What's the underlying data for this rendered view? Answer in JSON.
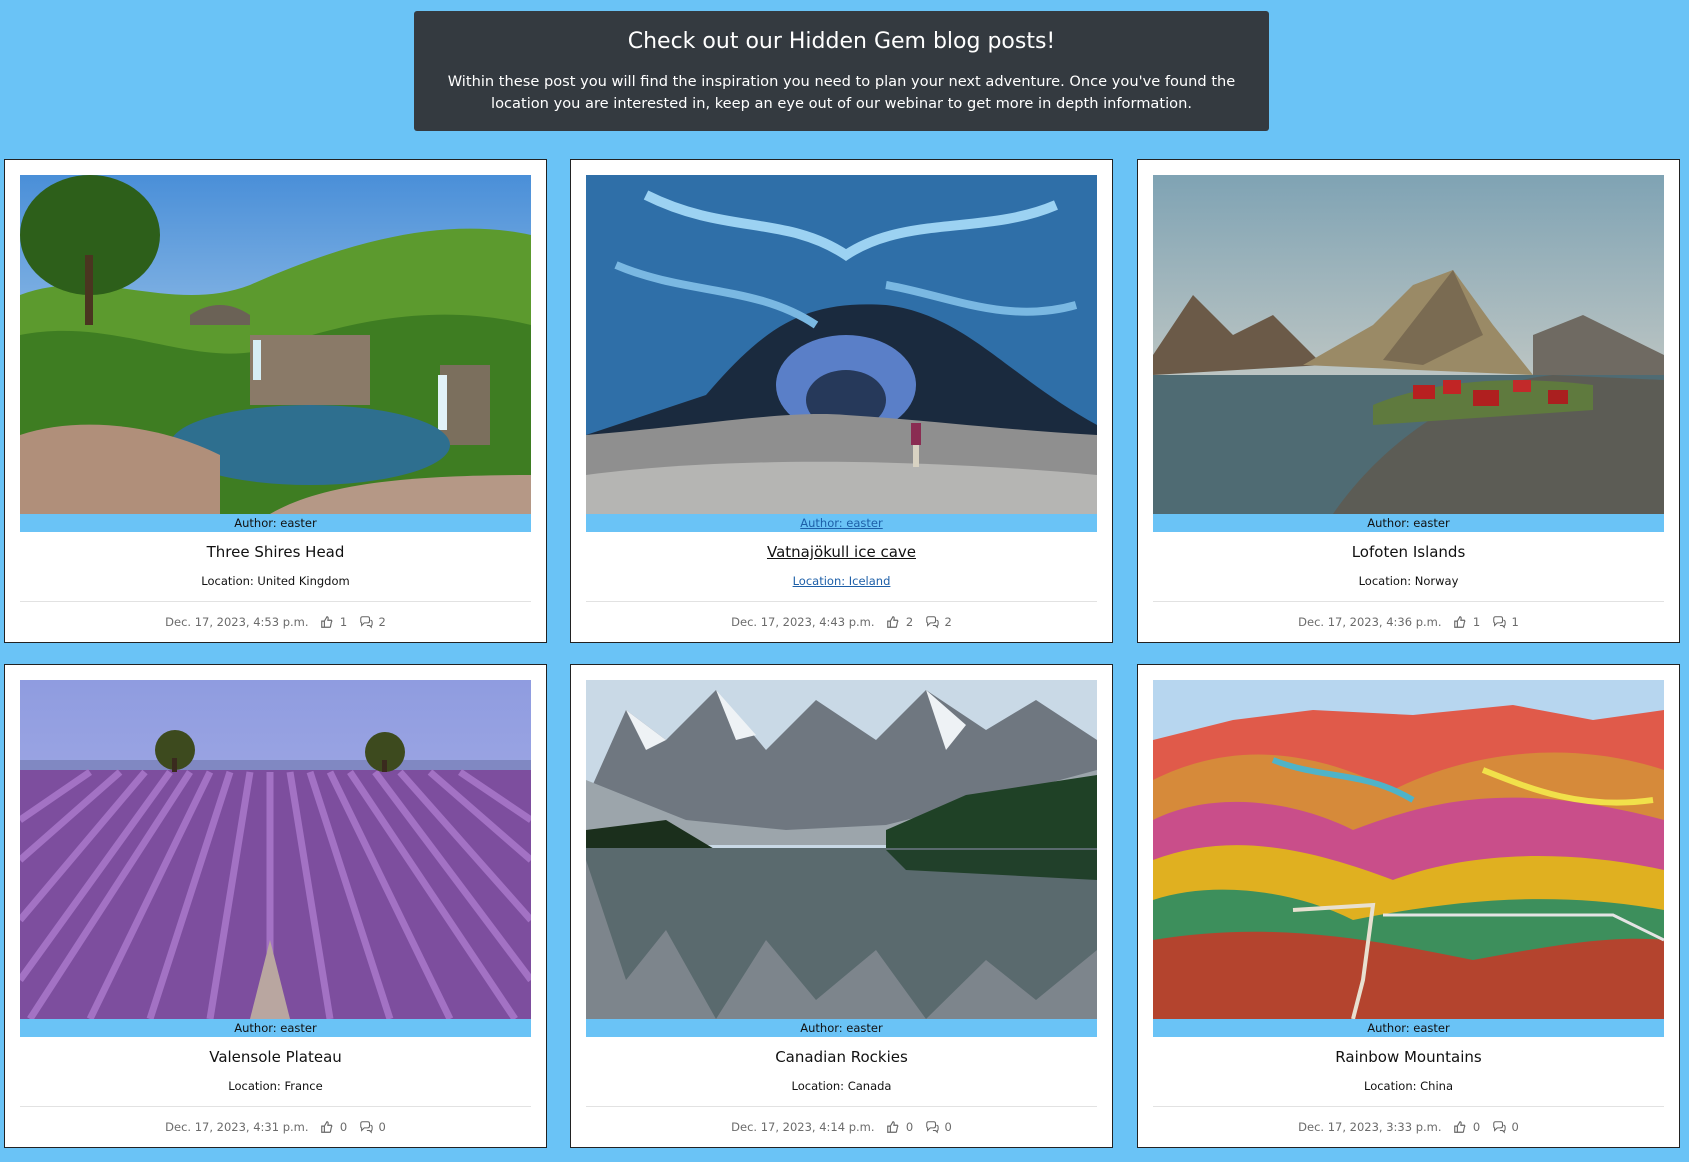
{
  "intro": {
    "heading": "Check out our Hidden Gem blog posts!",
    "text": "Within these post you will find the inspiration you need to plan your next adventure. Once you've found the location you are interested in, keep an eye out of our webinar to get more in depth information."
  },
  "icons": {
    "likes": "thumbs-up-icon",
    "comments": "comments-icon"
  },
  "posts": [
    {
      "author": "Author: easter",
      "title": "Three Shires Head",
      "location": "Location: United Kingdom",
      "date": "Dec. 17, 2023, 4:53 p.m.",
      "likes": "1",
      "comments": "2"
    },
    {
      "author": "Author: easter",
      "title": "Vatnajökull ice cave",
      "location": "Location: Iceland",
      "date": "Dec. 17, 2023, 4:43 p.m.",
      "likes": "2",
      "comments": "2"
    },
    {
      "author": "Author: easter",
      "title": "Lofoten Islands",
      "location": "Location: Norway",
      "date": "Dec. 17, 2023, 4:36 p.m.",
      "likes": "1",
      "comments": "1"
    },
    {
      "author": "Author: easter",
      "title": "Valensole Plateau",
      "location": "Location: France",
      "date": "Dec. 17, 2023, 4:31 p.m.",
      "likes": "0",
      "comments": "0"
    },
    {
      "author": "Author: easter",
      "title": "Canadian Rockies",
      "location": "Location: Canada",
      "date": "Dec. 17, 2023, 4:14 p.m.",
      "likes": "0",
      "comments": "0"
    },
    {
      "author": "Author: easter",
      "title": "Rainbow Mountains",
      "location": "Location: China",
      "date": "Dec. 17, 2023, 3:33 p.m.",
      "likes": "0",
      "comments": "0"
    }
  ],
  "colors": {
    "page_background": "#6ac3f6",
    "intro_background": "#343a40",
    "author_bar": "#6ac3f6",
    "link": "#1d5fa8"
  }
}
